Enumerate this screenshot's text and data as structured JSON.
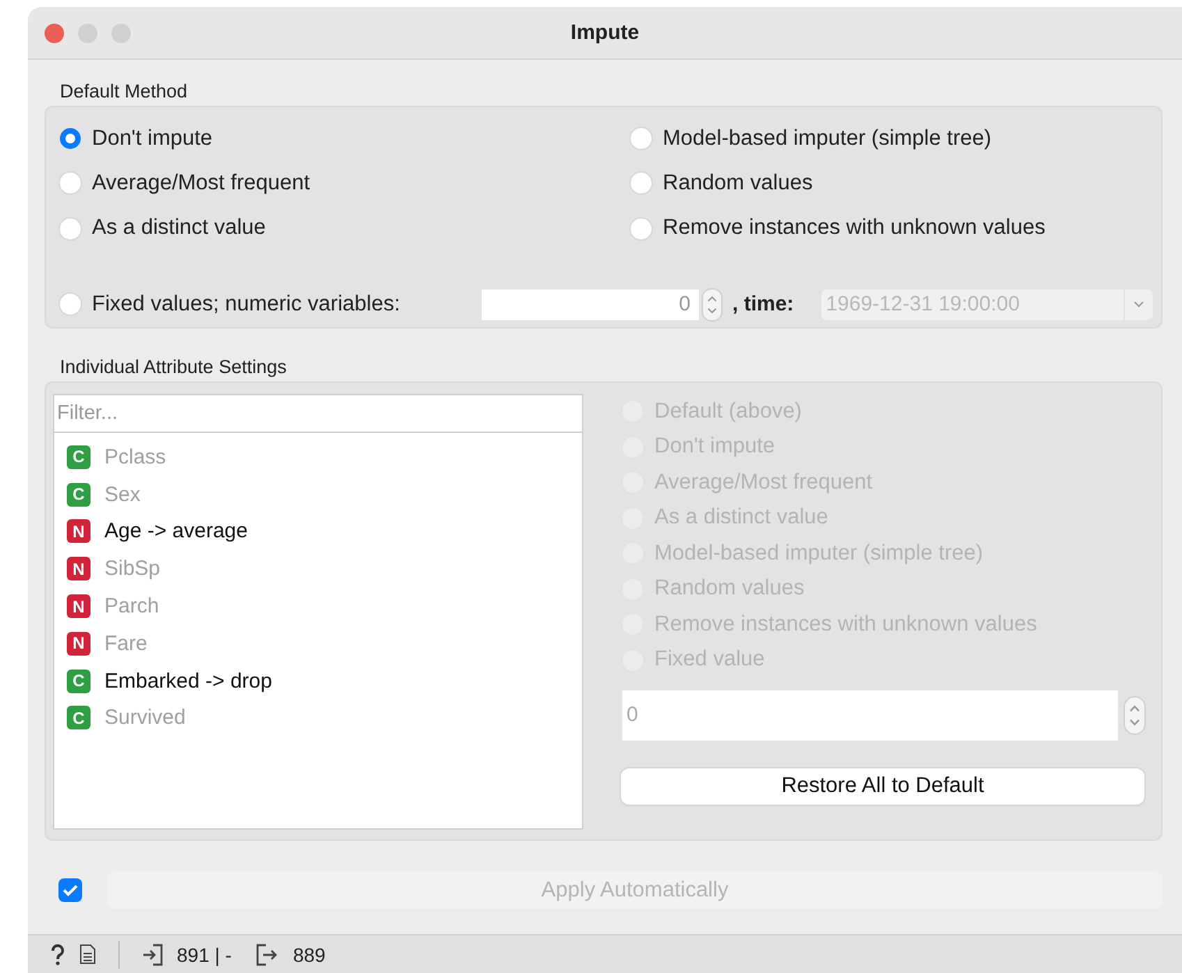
{
  "window": {
    "title": "Impute"
  },
  "default_method": {
    "title": "Default Method",
    "options": [
      {
        "label": "Don't impute",
        "selected": true
      },
      {
        "label": "Average/Most frequent",
        "selected": false
      },
      {
        "label": "As a distinct value",
        "selected": false
      },
      {
        "label": "Model-based imputer (simple tree)",
        "selected": false
      },
      {
        "label": "Random values",
        "selected": false
      },
      {
        "label": "Remove instances with unknown values",
        "selected": false
      }
    ],
    "fixed": {
      "label": "Fixed values; numeric variables:",
      "selected": false,
      "numeric_value": "0",
      "time_label": ", time:",
      "time_value": "1969-12-31 19:00:00",
      "time_disabled": true
    }
  },
  "individual": {
    "title": "Individual Attribute Settings",
    "filter_placeholder": "Filter...",
    "attributes": [
      {
        "type": "C",
        "color": "#2ea043",
        "name": "Pclass",
        "customized": false
      },
      {
        "type": "C",
        "color": "#2ea043",
        "name": "Sex",
        "customized": false
      },
      {
        "type": "N",
        "color": "#d1243a",
        "name": "Age -> average",
        "customized": true
      },
      {
        "type": "N",
        "color": "#d1243a",
        "name": "SibSp",
        "customized": false
      },
      {
        "type": "N",
        "color": "#d1243a",
        "name": "Parch",
        "customized": false
      },
      {
        "type": "N",
        "color": "#d1243a",
        "name": "Fare",
        "customized": false
      },
      {
        "type": "C",
        "color": "#2ea043",
        "name": "Embarked -> drop",
        "customized": true
      },
      {
        "type": "C",
        "color": "#2ea043",
        "name": "Survived",
        "customized": false
      }
    ],
    "methods_disabled": true,
    "methods": [
      {
        "label": "Default (above)",
        "selected": false
      },
      {
        "label": "Don't impute",
        "selected": false
      },
      {
        "label": "Average/Most frequent",
        "selected": false
      },
      {
        "label": "As a distinct value",
        "selected": false
      },
      {
        "label": "Model-based imputer (simple tree)",
        "selected": false
      },
      {
        "label": "Random values",
        "selected": false
      },
      {
        "label": "Remove instances with unknown values",
        "selected": false
      },
      {
        "label": "Fixed value",
        "selected": false
      }
    ],
    "fixed_value": "0",
    "restore_button": "Restore All to Default"
  },
  "apply": {
    "checked": true,
    "label": "Apply Automatically",
    "disabled": true
  },
  "status_bar": {
    "input_count": "891 | -",
    "output_count": "889"
  }
}
